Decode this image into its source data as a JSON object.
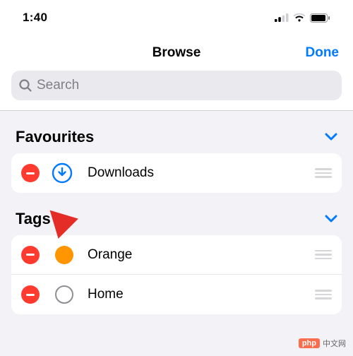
{
  "status": {
    "time": "1:40"
  },
  "nav": {
    "title": "Browse",
    "done": "Done"
  },
  "search": {
    "placeholder": "Search"
  },
  "favourites": {
    "title": "Favourites",
    "items": [
      {
        "label": "Downloads",
        "icon": "download-circle",
        "color": "#007aff"
      }
    ]
  },
  "tags": {
    "title": "Tags",
    "items": [
      {
        "label": "Orange",
        "kind": "filled",
        "color": "#ff9500"
      },
      {
        "label": "Home",
        "kind": "ring",
        "color": "#8e8e93"
      }
    ]
  },
  "watermark": {
    "logo": "php",
    "text": "中文网"
  },
  "colors": {
    "accent": "#007aff",
    "destructive": "#ff3b30",
    "orange": "#ff9500"
  }
}
